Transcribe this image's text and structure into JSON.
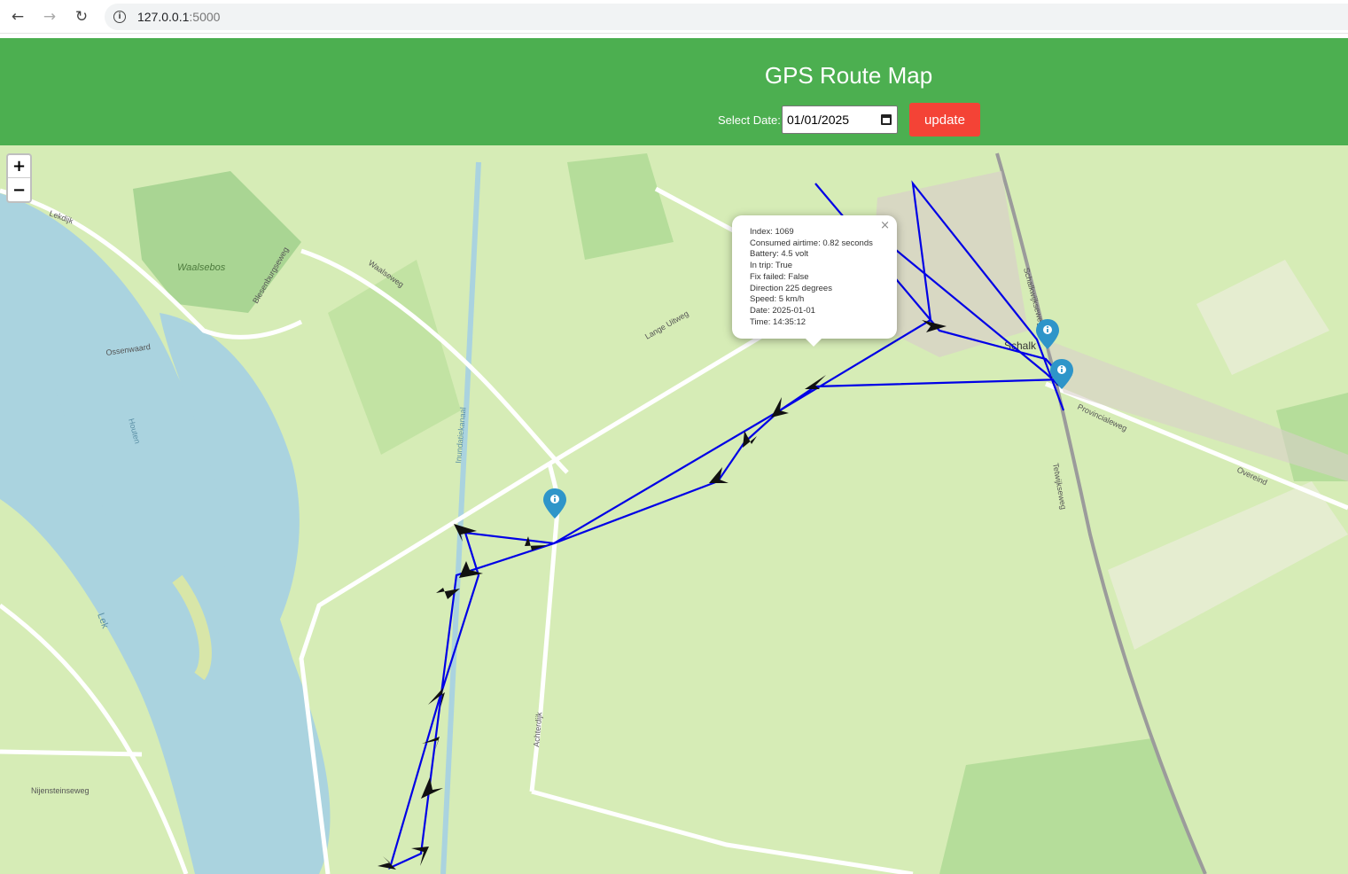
{
  "browser": {
    "url_host": "127.0.0.1",
    "url_port": ":5000",
    "icons": [
      "back-arrow-icon",
      "forward-arrow-icon",
      "reload-icon",
      "info-icon"
    ]
  },
  "header": {
    "title": "GPS Route Map",
    "date_label": "Select Date:",
    "date_value": "01/01/2025",
    "update_label": "update"
  },
  "zoom": {
    "in": "+",
    "out": "−"
  },
  "popup": {
    "close": "×",
    "lines": [
      "Index: 1069",
      "Consumed airtime: 0.82 seconds",
      "Battery: 4.5 volt",
      "In trip: True",
      "Fix failed: False",
      "Direction 225 degrees",
      "Speed: 5 km/h",
      "Date: 2025-01-01",
      "Time: 14:35:12"
    ]
  },
  "map_labels": {
    "lekdijk": "Lekdijk",
    "waalsebos": "Waalsebos",
    "waalseweg": "Waalseweg",
    "ossenwaard": "Ossenwaard",
    "lange_uitweg": "Lange Uitweg",
    "lek": "Lek",
    "achterdijk": "Achterdijk",
    "provincialeweg": "Provincialeweg",
    "overeind": "Overeind",
    "nijensteinseweg": "Nijensteinseweg",
    "schalkwijk": "Schalk",
    "schalkwijkseweg": "Schalkwijkseweg",
    "blesenburgseweg": "Blesenburgseweg",
    "inundatiekanaal": "Inundatiekanaal",
    "houten": "Houten",
    "tetwijkseweg": "Tetwijkseweg"
  }
}
